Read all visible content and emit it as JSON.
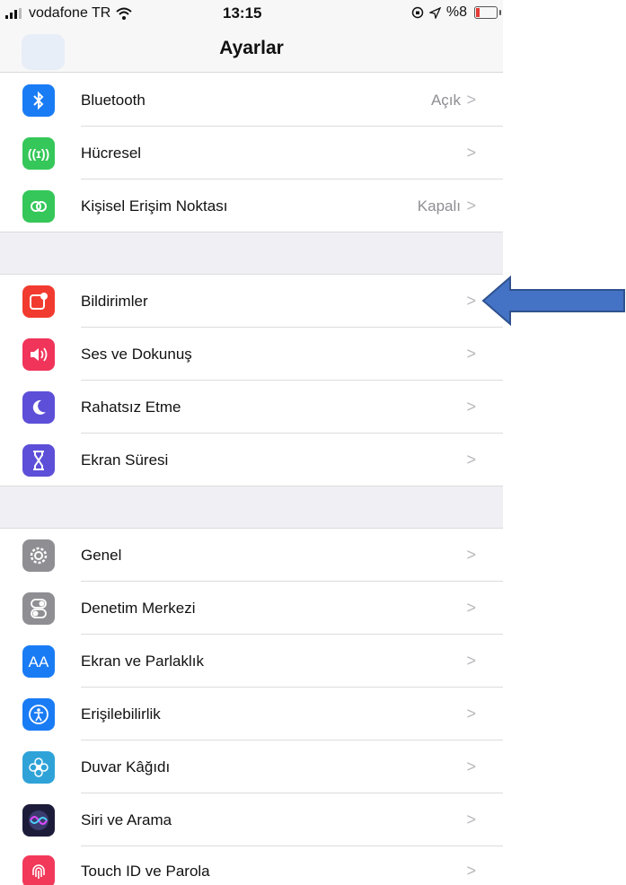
{
  "status_bar": {
    "carrier": "vodafone TR",
    "time": "13:15",
    "battery": "%8"
  },
  "nav": {
    "title": "Ayarlar"
  },
  "groups": [
    {
      "rows": [
        {
          "label": "Bluetooth",
          "value": "Açık",
          "icon": "bluetooth-icon",
          "color": "#1a7cf5"
        },
        {
          "label": "Hücresel",
          "value": "",
          "icon": "cellular-icon",
          "color": "#35c759"
        },
        {
          "label": "Kişisel Erişim Noktası",
          "value": "Kapalı",
          "icon": "hotspot-icon",
          "color": "#35c759"
        }
      ]
    },
    {
      "rows": [
        {
          "label": "Bildirimler",
          "value": "",
          "icon": "notifications-icon",
          "color": "#f23b30"
        },
        {
          "label": "Ses ve Dokunuş",
          "value": "",
          "icon": "sound-icon",
          "color": "#f0345a"
        },
        {
          "label": "Rahatsız Etme",
          "value": "",
          "icon": "moon-icon",
          "color": "#5d4fd8"
        },
        {
          "label": "Ekran Süresi",
          "value": "",
          "icon": "hourglass-icon",
          "color": "#5d4fd8"
        }
      ]
    },
    {
      "rows": [
        {
          "label": "Genel",
          "value": "",
          "icon": "gear-icon",
          "color": "#8e8e93"
        },
        {
          "label": "Denetim Merkezi",
          "value": "",
          "icon": "switches-icon",
          "color": "#8e8e93"
        },
        {
          "label": "Ekran ve Parlaklık",
          "value": "",
          "icon": "text-size-icon",
          "color": "#1a7cf5"
        },
        {
          "label": "Erişilebilirlik",
          "value": "",
          "icon": "accessibility-icon",
          "color": "#1a7cf5"
        },
        {
          "label": "Duvar Kâğıdı",
          "value": "",
          "icon": "flower-icon",
          "color": "#2fa3d8"
        },
        {
          "label": "Siri ve Arama",
          "value": "",
          "icon": "siri-icon",
          "color": "#222244"
        },
        {
          "label": "Touch ID ve Parola",
          "value": "",
          "icon": "fingerprint-icon",
          "color": "#f2395a"
        }
      ]
    }
  ],
  "annotation": {
    "icon": "arrow-left-icon",
    "color": "#4472c4"
  }
}
